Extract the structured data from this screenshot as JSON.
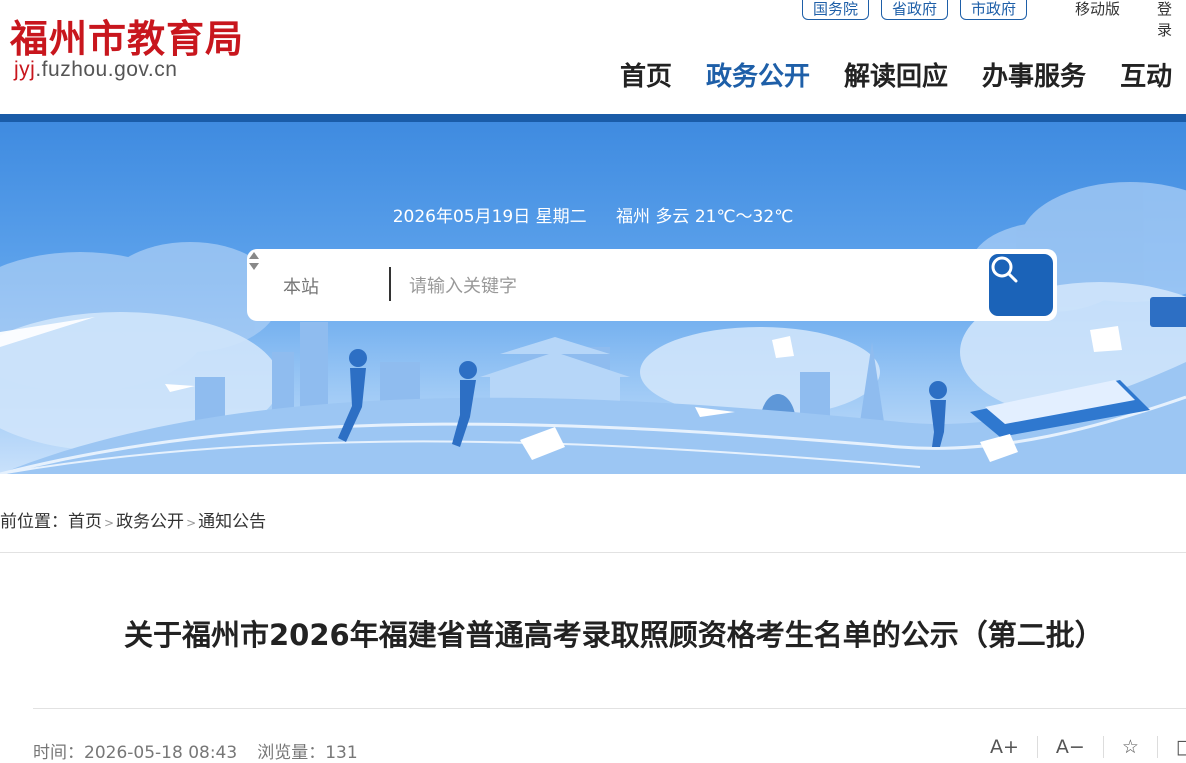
{
  "header": {
    "logo_cn": "福州市教育局",
    "logo_url_highlight": "jyj",
    "logo_url_rest": ".fuzhou.gov.cn",
    "top_links": [
      "国务院",
      "省政府",
      "市政府"
    ],
    "mobile_label": "移动版",
    "login_label": "登录",
    "nav": [
      "首页",
      "政务公开",
      "解读回应",
      "办事服务",
      "互动"
    ],
    "nav_active": "政务公开"
  },
  "banner": {
    "date": "2026年05月19日 星期二",
    "weather": "福州 多云 21℃～32℃",
    "search_scope": "本站",
    "search_placeholder": "请输入关键字"
  },
  "breadcrumb": {
    "prefix": "前位置：",
    "items": [
      "首页",
      "政务公开",
      "通知公告"
    ],
    "separator": ">"
  },
  "article": {
    "title": "关于福州市2026年福建省普通高考录取照顾资格考生名单的公示（第二批）",
    "time_label": "时间：",
    "time_value": "2026-05-18 08:43",
    "views_label": "浏览量：",
    "views_value": "131",
    "tools": [
      "A+",
      "A−",
      "☆",
      "□"
    ]
  },
  "colors": {
    "brand_red": "#c8161d",
    "brand_blue": "#1a5ca8",
    "search_button": "#1b63b8"
  }
}
